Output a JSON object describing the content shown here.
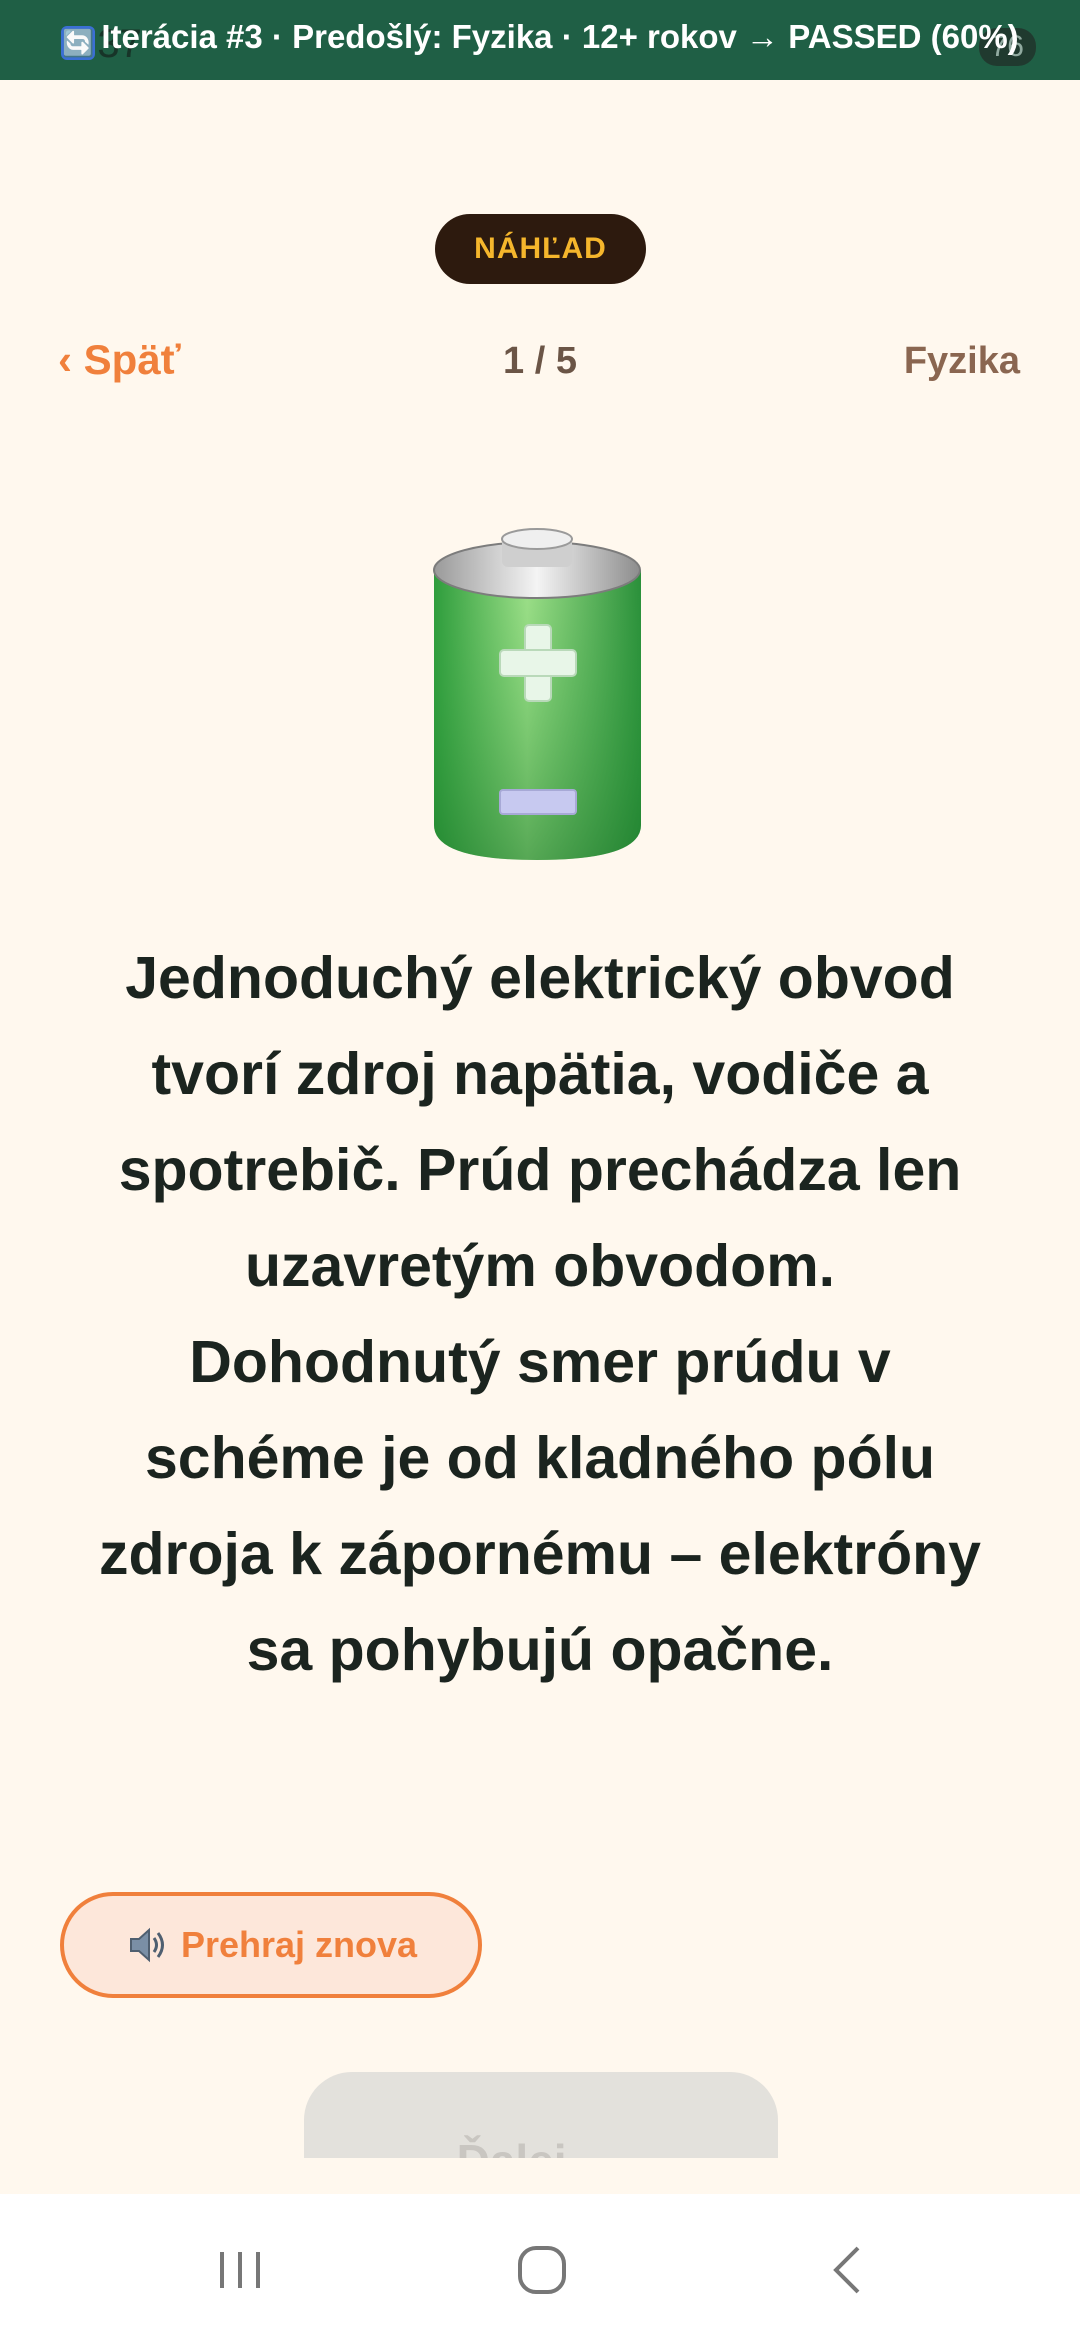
{
  "banner": {
    "emoji": "🔄",
    "text": "Iterácia #3 · Predošlý: Fyzika · 12+ rokov → PASSED (60%)"
  },
  "status_bar": {
    "time": "4:37",
    "battery": "76"
  },
  "badge": {
    "label": "NÁHĽAD"
  },
  "header": {
    "back_label": "‹ Späť",
    "progress": "1 / 5",
    "subject": "Fyzika"
  },
  "lesson": {
    "icon": "battery-icon",
    "text": "Jednoduchý elektrický obvod tvorí zdroj napätia, vodiče a spotrebič. Prúd prechádza len uzavretým obvodom. Dohodnutý smer prúdu v schéme je od kladného pólu zdroja k zápornému – elektróny sa pohybujú opačne."
  },
  "replay_button": {
    "icon": "speaker-icon",
    "label": "Prehraj znova"
  },
  "next_button": {
    "label": "Ďalej →",
    "enabled": false
  },
  "navbar": {
    "icons": [
      "recent-apps-icon",
      "home-icon",
      "back-icon"
    ]
  },
  "colors": {
    "banner": "#1f5f45",
    "background": "#fff8ee",
    "accent": "#f0803c",
    "badge_bg": "#2d1a0e",
    "badge_text": "#f5b62c"
  }
}
